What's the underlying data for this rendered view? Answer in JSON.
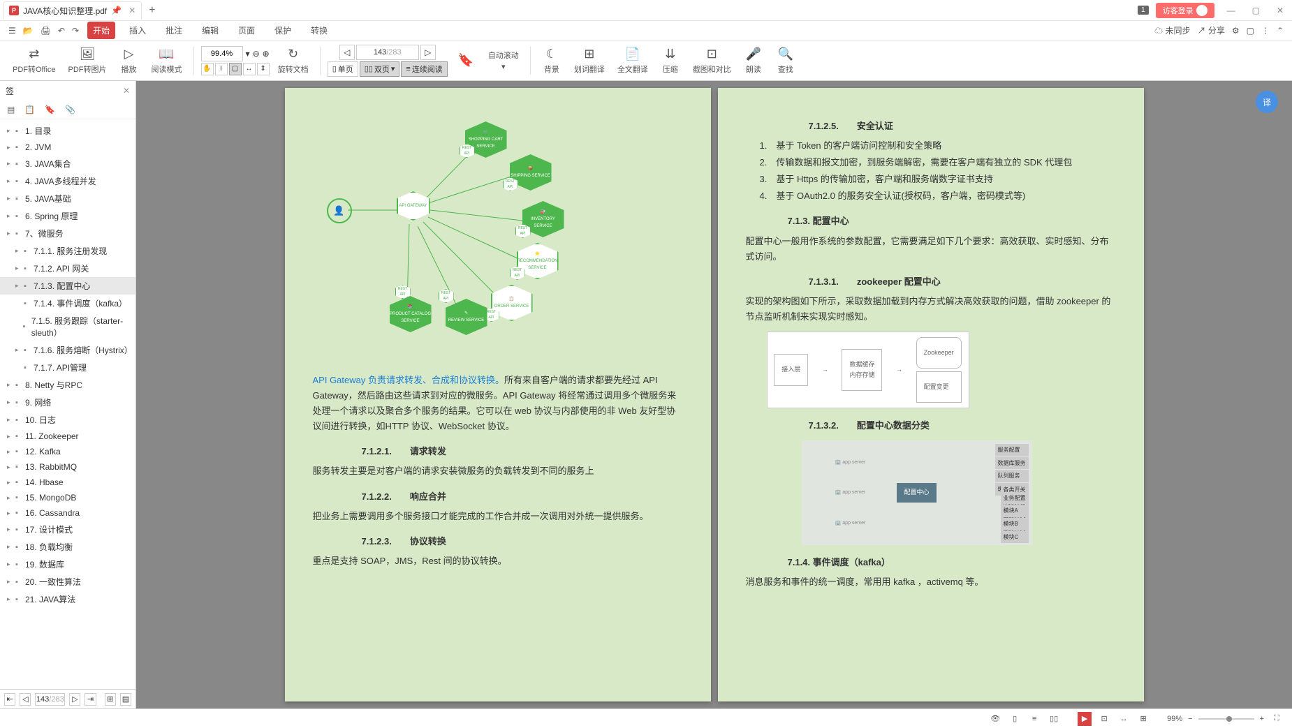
{
  "titlebar": {
    "tab_name": "JAVA核心知识整理.pdf",
    "badge": "1",
    "login": "访客登录"
  },
  "menubar": {
    "tabs": [
      "开始",
      "插入",
      "批注",
      "编辑",
      "页面",
      "保护",
      "转换"
    ],
    "right": {
      "unsync": "未同步",
      "share": "分享"
    }
  },
  "toolbar": {
    "pdf_office": "PDF转Office",
    "pdf_image": "PDF转图片",
    "play": "播放",
    "read_mode": "阅读模式",
    "zoom": "99.4%",
    "rotate": "旋转文档",
    "single": "单页",
    "double": "双页",
    "continuous": "连续阅读",
    "auto_scroll": "自动滚动",
    "page_cur": "143",
    "page_total": "/283",
    "background": "背景",
    "word_trans": "划词翻译",
    "full_trans": "全文翻译",
    "compress": "压缩",
    "crop_compare": "截图和对比",
    "read_aloud": "朗读",
    "find": "查找"
  },
  "sidebar": {
    "title": "签",
    "items": [
      {
        "text": "1. 目录",
        "lvl": 1,
        "arrow": true
      },
      {
        "text": "2. JVM",
        "lvl": 1,
        "arrow": true
      },
      {
        "text": "3. JAVA集合",
        "lvl": 1,
        "arrow": true
      },
      {
        "text": "4. JAVA多线程并发",
        "lvl": 1,
        "arrow": true
      },
      {
        "text": "5. JAVA基础",
        "lvl": 1,
        "arrow": true
      },
      {
        "text": "6. Spring 原理",
        "lvl": 1,
        "arrow": true
      },
      {
        "text": "7、微服务",
        "lvl": 1,
        "arrow": true
      },
      {
        "text": "7.1.1. 服务注册发现",
        "lvl": 2,
        "arrow": true
      },
      {
        "text": "7.1.2. API 网关",
        "lvl": 2,
        "arrow": true
      },
      {
        "text": "7.1.3. 配置中心",
        "lvl": 2,
        "arrow": true,
        "selected": true
      },
      {
        "text": "7.1.4. 事件调度（kafka）",
        "lvl": 3
      },
      {
        "text": "7.1.5. 服务跟踪（starter-sleuth）",
        "lvl": 3
      },
      {
        "text": "7.1.6. 服务熔断（Hystrix）",
        "lvl": 2,
        "arrow": true
      },
      {
        "text": "7.1.7. API管理",
        "lvl": 3
      },
      {
        "text": "8. Netty 与RPC",
        "lvl": 1,
        "arrow": true
      },
      {
        "text": "9. 网络",
        "lvl": 1,
        "arrow": true
      },
      {
        "text": "10. 日志",
        "lvl": 1,
        "arrow": true
      },
      {
        "text": "11. Zookeeper",
        "lvl": 1,
        "arrow": true
      },
      {
        "text": "12. Kafka",
        "lvl": 1,
        "arrow": true
      },
      {
        "text": "13. RabbitMQ",
        "lvl": 1,
        "arrow": true
      },
      {
        "text": "14. Hbase",
        "lvl": 1,
        "arrow": true
      },
      {
        "text": "15. MongoDB",
        "lvl": 1,
        "arrow": true
      },
      {
        "text": "16. Cassandra",
        "lvl": 1,
        "arrow": true
      },
      {
        "text": "17. 设计模式",
        "lvl": 1,
        "arrow": true
      },
      {
        "text": "18. 负载均衡",
        "lvl": 1,
        "arrow": true
      },
      {
        "text": "19. 数据库",
        "lvl": 1,
        "arrow": true
      },
      {
        "text": "20. 一致性算法",
        "lvl": 1,
        "arrow": true
      },
      {
        "text": "21. JAVA算法",
        "lvl": 1,
        "arrow": true
      }
    ],
    "footer": {
      "page_cur": "143",
      "page_total": "/283"
    }
  },
  "doc": {
    "page_left": {
      "intro_link": "API Gateway 负责请求转发、合成和协议转换。",
      "intro_rest": "所有来自客户端的请求都要先经过 API Gateway，然后路由这些请求到对应的微服务。API Gateway 将经常通过调用多个微服务来处理一个请求以及聚合多个服务的结果。它可以在 web 协议与内部使用的非 Web 友好型协议间进行转换，如HTTP 协议、WebSocket 协议。",
      "h7121": "7.1.2.1.　　请求转发",
      "p7121": "服务转发主要是对客户端的请求安装微服务的负载转发到不同的服务上",
      "h7122": "7.1.2.2.　　响应合并",
      "p7122": "把业务上需要调用多个服务接口才能完成的工作合并成一次调用对外统一提供服务。",
      "h7123": "7.1.2.3.　　协议转换",
      "p7123": "重点是支持 SOAP，JMS，Rest 间的协议转换。",
      "nodes": {
        "cart": "SHOPPING CART SERVICE",
        "ship": "SHIPPING SERVICE",
        "inv": "INVENTORY SERVICE",
        "rec": "RECOMMENDATION SERVICE",
        "order": "ORDER SERVICE",
        "review": "REVIEW SERVICE",
        "catalog": "PRODUCT CATALOG SERVICE",
        "gw": "API GATEWAY",
        "rest": "REST API"
      }
    },
    "page_right": {
      "h7125": "7.1.2.5.　　安全认证",
      "li1": "1.　基于 Token 的客户端访问控制和安全策略",
      "li2": "2.　传输数据和报文加密，到服务端解密，需要在客户端有独立的 SDK 代理包",
      "li3": "3.　基于 Https 的传输加密，客户端和服务端数字证书支持",
      "li4": "4.　基于 OAuth2.0 的服务安全认证(授权码，客户端，密码模式等)",
      "h713": "7.1.3. 配置中心",
      "p713": "配置中心一般用作系统的参数配置，它需要满足如下几个要求：高效获取、实时感知、分布式访问。",
      "h7131": "7.1.3.1.　　zookeeper 配置中心",
      "p7131": "实现的架构图如下所示，采取数据加载到内存方式解决高效获取的问题，借助 zookeeper 的节点监听机制来实现实时感知。",
      "h7132": "7.1.3.2.　　配置中心数据分类",
      "cat_center": "配置中心",
      "h714": "7.1.4. 事件调度（kafka）",
      "p714": "消息服务和事件的统一调度，常用用 kafka ，activemq 等。"
    }
  },
  "statusbar": {
    "zoom": "99%"
  }
}
